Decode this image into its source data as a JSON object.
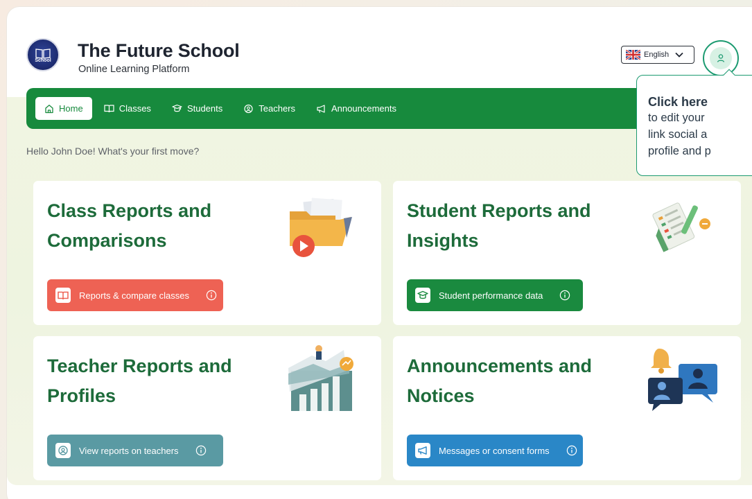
{
  "header": {
    "title": "The Future School",
    "subtitle": "Online Learning Platform",
    "logo_text": "School"
  },
  "language": {
    "selected": "English"
  },
  "nav": {
    "items": [
      {
        "label": "Home",
        "icon": "home-icon",
        "active": true
      },
      {
        "label": "Classes",
        "icon": "book-icon"
      },
      {
        "label": "Students",
        "icon": "graduation-cap-icon"
      },
      {
        "label": "Teachers",
        "icon": "teacher-icon"
      },
      {
        "label": "Announcements",
        "icon": "megaphone-icon"
      }
    ]
  },
  "greeting": "Hello John Doe! What's your first move?",
  "tooltip": {
    "heading": "Click here",
    "lines": [
      "to edit your",
      "link social a",
      "profile and p"
    ]
  },
  "cards": [
    {
      "title_line1": "Class Reports and",
      "title_line2": "Comparisons",
      "button_label": "Reports & compare classes",
      "color": "#ee6254"
    },
    {
      "title_line1": "Student Reports and",
      "title_line2": "Insights",
      "button_label": "Student performance data",
      "color": "#1a8a3f"
    },
    {
      "title_line1": "Teacher Reports and",
      "title_line2": "Profiles",
      "button_label": "View reports on teachers",
      "color": "#5a9aa3"
    },
    {
      "title_line1": "Announcements and",
      "title_line2": "Notices",
      "button_label": "Messages or consent forms",
      "color": "#2a87c7"
    }
  ],
  "colors": {
    "primary_green": "#178a3d",
    "title_green": "#1d6b3a",
    "accent_teal": "#1b9a70"
  }
}
